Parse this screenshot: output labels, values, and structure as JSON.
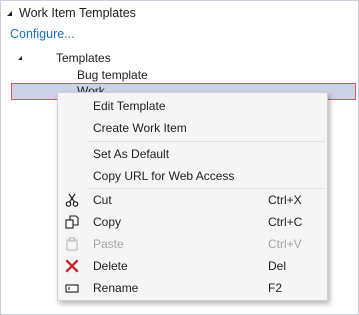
{
  "panel": {
    "title": "Work Item Templates",
    "configure_link": "Configure...",
    "tree": {
      "root_label": "Templates",
      "items": [
        "Bug template",
        "Work..."
      ]
    }
  },
  "context_menu": {
    "items": [
      {
        "label": "Edit Template",
        "shortcut": "",
        "icon": "",
        "enabled": true
      },
      {
        "label": "Create Work Item",
        "shortcut": "",
        "icon": "",
        "enabled": true
      },
      {
        "label": "Set As Default",
        "shortcut": "",
        "icon": "",
        "enabled": true
      },
      {
        "label": "Copy URL for Web Access",
        "shortcut": "",
        "icon": "",
        "enabled": true
      },
      {
        "label": "Cut",
        "shortcut": "Ctrl+X",
        "icon": "scissors-icon",
        "enabled": true
      },
      {
        "label": "Copy",
        "shortcut": "Ctrl+C",
        "icon": "copy-icon",
        "enabled": true
      },
      {
        "label": "Paste",
        "shortcut": "Ctrl+V",
        "icon": "paste-icon",
        "enabled": false
      },
      {
        "label": "Delete",
        "shortcut": "Del",
        "icon": "delete-x-icon",
        "enabled": true
      },
      {
        "label": "Rename",
        "shortcut": "F2",
        "icon": "rename-icon",
        "enabled": true
      }
    ]
  },
  "colors": {
    "link": "#1a6fc4",
    "selected_row_bg": "#cdd3e6",
    "selected_row_border": "#e0535d",
    "delete_icon": "#c5282f",
    "disabled_text": "#a2a4a5"
  }
}
